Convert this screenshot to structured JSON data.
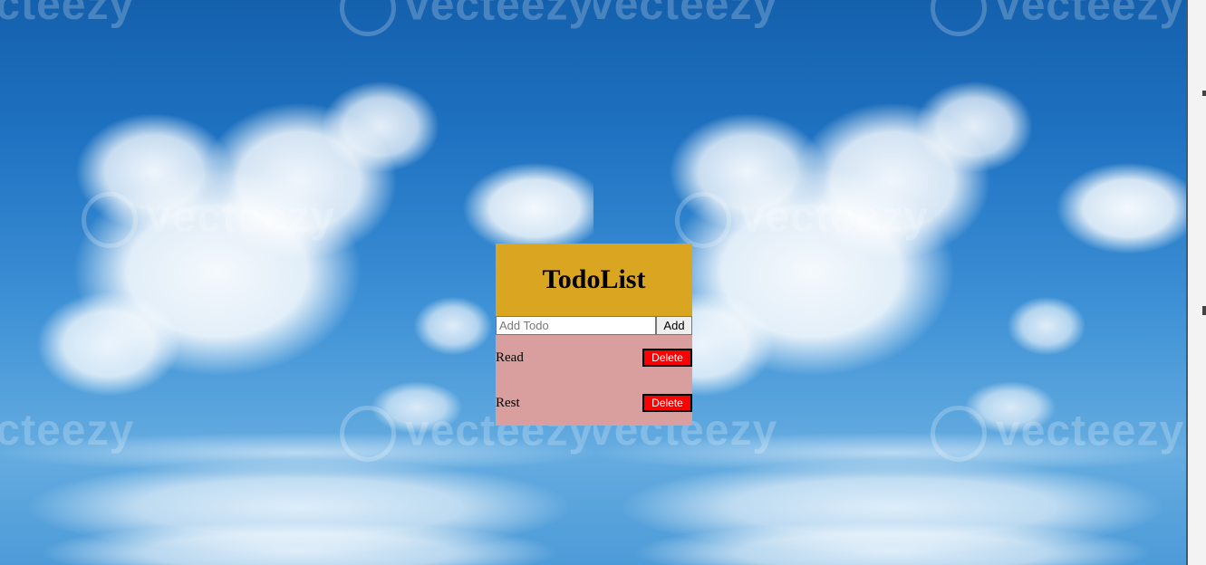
{
  "background": {
    "watermark_text": "vecteezy",
    "sky_color": "#1f73c2"
  },
  "app": {
    "title": "TodoList",
    "header_color": "#daa520",
    "list_color": "#d99e9e"
  },
  "form": {
    "input_placeholder": "Add Todo",
    "input_value": "",
    "add_label": "Add"
  },
  "todos": [
    {
      "text": "Read",
      "delete_label": "Delete"
    },
    {
      "text": "Rest",
      "delete_label": "Delete"
    }
  ]
}
